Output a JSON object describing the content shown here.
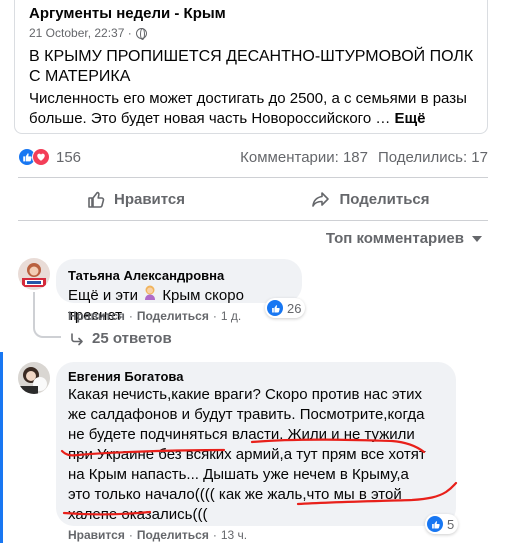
{
  "shared_post": {
    "source": "Аргументы недели - Крым",
    "date": "21 October, 22:37 ·",
    "headline": "В Крыму пропишется десантно-штурмовой полк с материка",
    "excerpt": "Численность его может достигать до 2500, а с семьями в разы больше. Это будет новая часть Новороссийского … ",
    "more": "Ещё"
  },
  "stats": {
    "reactions_count": "156",
    "comments": "Комментарии: 187",
    "shares": "Поделились: 17"
  },
  "actions": {
    "like": "Нравится",
    "share": "Поделиться"
  },
  "sort_label": "Топ комментариев",
  "comments": [
    {
      "author": "Татьяна Александровна",
      "text_before": "Ещё и эти",
      "text_after": " Крым скоро треснет",
      "like": "Нравится",
      "reply": "Поделиться",
      "time": "1 д.",
      "reactions": "26",
      "replies_label": "25 ответов"
    },
    {
      "author": "Евгения Богатова",
      "text": "Какая нечисть,какие враги? Скоро против нас этих же салдафонов и будут травить. Посмотрите,когда не будете подчиняться власти. Жили и не тужили при Украине без всяких армий,а тут прям все хотят на Крым напасть... Дышать уже нечем в Крыму,а это только начало(((( как же жаль,что мы в этой халепе оказались(((",
      "like": "Нравится",
      "reply": "Поделиться",
      "time": "13 ч.",
      "reactions": "5"
    }
  ],
  "colors": {
    "accent": "#1877f2",
    "love": "#f33e58",
    "annotation": "#e8201a",
    "muted": "#65676b"
  },
  "icons": [
    "globe-icon",
    "like-reaction-icon",
    "love-reaction-icon",
    "thumbs-up-icon",
    "share-arrow-icon",
    "chevron-down-icon",
    "reply-arrow-icon",
    "woman-emoji-icon"
  ]
}
